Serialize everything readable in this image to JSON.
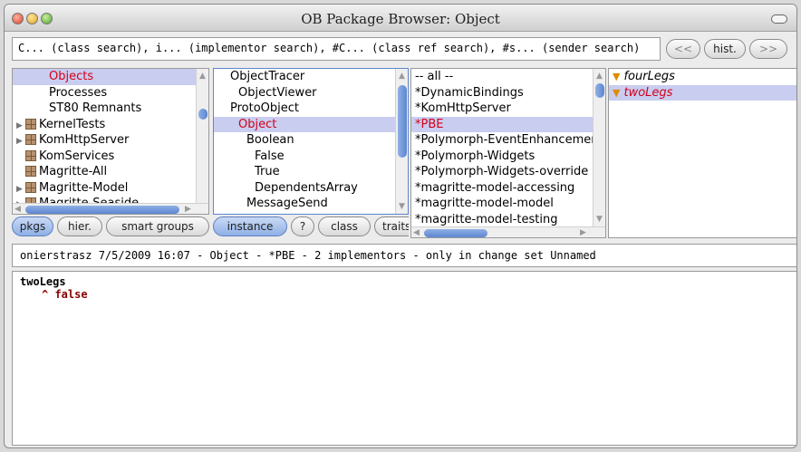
{
  "window": {
    "title": "OB Package Browser: Object"
  },
  "search": {
    "value": "C... (class search), i... (implementor search), #C... (class ref search), #s... (sender search)",
    "back": "<<",
    "hist": "hist.",
    "forward": ">>"
  },
  "packages": {
    "items": [
      {
        "label": "Objects",
        "selected": true,
        "icon": "none"
      },
      {
        "label": "Processes",
        "icon": "none"
      },
      {
        "label": "ST80 Remnants",
        "icon": "none"
      },
      {
        "label": "KernelTests",
        "icon": "package-icon",
        "expand": true
      },
      {
        "label": "KomHttpServer",
        "icon": "package-icon",
        "expand": true
      },
      {
        "label": "KomServices",
        "icon": "package-icon"
      },
      {
        "label": "Magritte-All",
        "icon": "package-icon"
      },
      {
        "label": "Magritte-Model",
        "icon": "package-icon",
        "expand": true
      },
      {
        "label": "Magritte-Seaside",
        "icon": "package-icon",
        "expand": true
      }
    ]
  },
  "classes": {
    "items": [
      {
        "label": "ObjectTracer",
        "indent": 1
      },
      {
        "label": "ObjectViewer",
        "indent": 2
      },
      {
        "label": "ProtoObject",
        "indent": 1
      },
      {
        "label": "Object",
        "indent": 2,
        "selected": true
      },
      {
        "label": "Boolean",
        "indent": 3
      },
      {
        "label": "False",
        "indent": 4
      },
      {
        "label": "True",
        "indent": 4
      },
      {
        "label": "DependentsArray",
        "indent": 4
      },
      {
        "label": "MessageSend",
        "indent": 3
      }
    ]
  },
  "protocols": {
    "items": [
      {
        "label": "-- all --"
      },
      {
        "label": "*DynamicBindings"
      },
      {
        "label": "*KomHttpServer"
      },
      {
        "label": "*PBE",
        "selected": true
      },
      {
        "label": "*Polymorph-EventEnhancements"
      },
      {
        "label": "*Polymorph-Widgets"
      },
      {
        "label": "*Polymorph-Widgets-override"
      },
      {
        "label": "*magritte-model-accessing"
      },
      {
        "label": "*magritte-model-model"
      },
      {
        "label": "*magritte-model-testing"
      }
    ]
  },
  "methods": {
    "items": [
      {
        "label": "fourLegs"
      },
      {
        "label": "twoLegs",
        "selected": true
      }
    ]
  },
  "buttons": {
    "pkgs": "pkgs",
    "hier": "hier.",
    "smart_groups": "smart groups",
    "instance": "instance",
    "help": "?",
    "class": "class",
    "traits": "traits"
  },
  "status": {
    "text": "onierstrasz 7/5/2009 16:07 - Object - *PBE - 2 implementors - only in change set Unnamed"
  },
  "code": {
    "selector": "twoLegs",
    "body": "^ false"
  },
  "colors": {
    "selection_bg": "#c9cdf0",
    "selection_text": "#d4001a",
    "accent_blue": "#5d86cf"
  }
}
